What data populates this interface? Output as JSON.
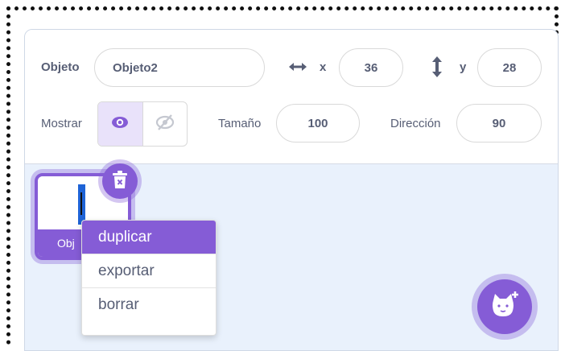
{
  "sprite_info": {
    "sprite_label": "Objeto",
    "sprite_name": "Objeto2",
    "x_label": "x",
    "x_value": "36",
    "y_label": "y",
    "y_value": "28",
    "show_label": "Mostrar",
    "size_label": "Tamaño",
    "size_value": "100",
    "direction_label": "Dirección",
    "direction_value": "90",
    "show_visible": true
  },
  "sprite_list": {
    "selected_sprite_caption": "Obj"
  },
  "context_menu": {
    "items": [
      {
        "label": "duplicar",
        "active": true
      },
      {
        "label": "exportar",
        "active": false
      },
      {
        "label": "borrar",
        "active": false
      }
    ]
  },
  "colors": {
    "accent": "#855cd6",
    "text": "#575e75",
    "pane_bg": "#e9f1fc"
  },
  "icons": [
    "horizontal-arrows-icon",
    "vertical-arrows-icon",
    "eye-icon",
    "eye-slash-icon",
    "trash-icon",
    "cat-add-icon"
  ]
}
